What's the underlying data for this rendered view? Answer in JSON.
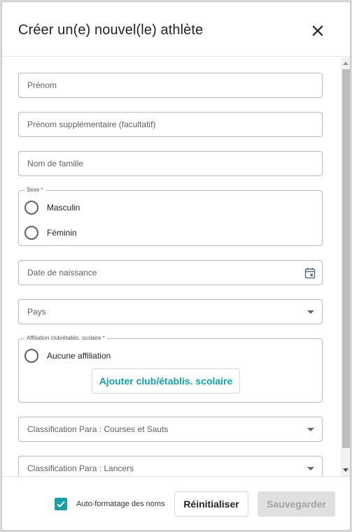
{
  "dialog": {
    "title": "Créer un(e) nouvel(le) athlète"
  },
  "fields": {
    "first_name_placeholder": "Prénom",
    "additional_name_placeholder": "Prénom supplémentaire (facultatif)",
    "last_name_placeholder": "Nom de famille",
    "birthdate_placeholder": "Date de naissance",
    "country_placeholder": "Pays",
    "para_track_placeholder": "Classification Para : Courses et Sauts",
    "para_throws_placeholder": "Classification Para : Lancers"
  },
  "sex_group": {
    "legend": "Sexe *",
    "options": [
      "Masculin",
      "Féminin"
    ]
  },
  "affiliation_group": {
    "legend": "Affiliation club/établis. scolaire *",
    "option": "Aucune affiliation",
    "add_button": "Ajouter club/établis. scolaire"
  },
  "footer": {
    "auto_format_label": "Auto-formatage des noms",
    "auto_format_checked": true,
    "reset_label": "Réinitialiser",
    "save_label": "Sauvegarder"
  },
  "colors": {
    "accent": "#1a9ea5",
    "disabled_bg": "#e0e0e0",
    "disabled_text": "#a3a3a3"
  },
  "icons": {
    "close": "close-icon",
    "calendar": "calendar-icon",
    "dropdown": "dropdown-arrow-icon",
    "check": "checkmark-icon"
  }
}
